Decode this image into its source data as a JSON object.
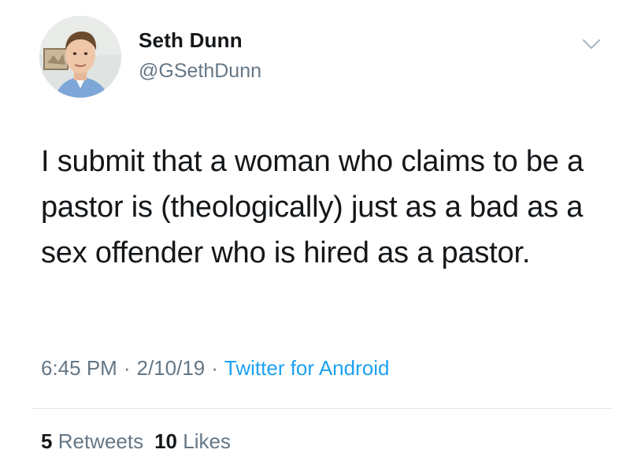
{
  "user": {
    "name": "Seth Dunn",
    "handle": "@GSethDunn"
  },
  "tweet": {
    "text": "I submit that a woman who claims to be a pastor is (theologically) just as a bad as a sex offender who is hired as a pastor."
  },
  "meta": {
    "time": "6:45 PM",
    "date": "2/10/19",
    "separator": "·",
    "source": "Twitter for Android"
  },
  "stats": {
    "retweets_count": "5",
    "retweets_label": "Retweets",
    "likes_count": "10",
    "likes_label": "Likes"
  },
  "colors": {
    "text": "#14171a",
    "secondary": "#657786",
    "link": "#1da1f2",
    "divider": "#e1e8ed"
  },
  "icons": {
    "menu": "chevron-down-icon"
  }
}
